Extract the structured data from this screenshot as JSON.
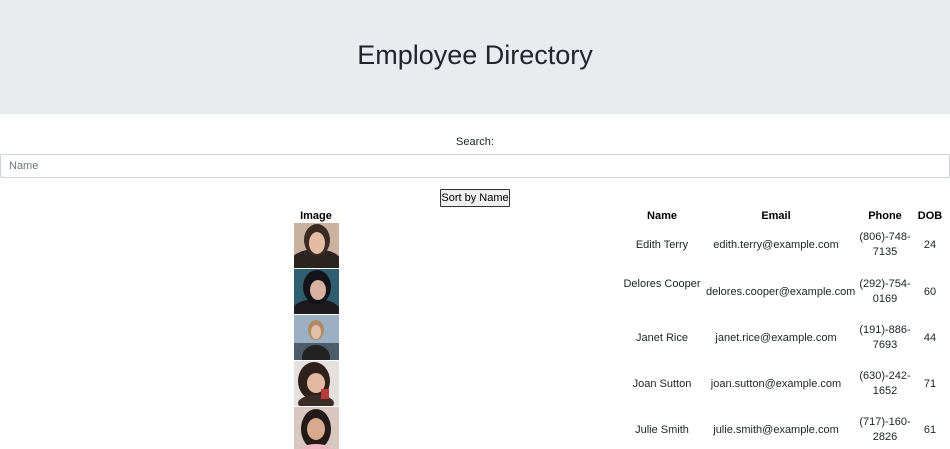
{
  "header": {
    "title": "Employee Directory"
  },
  "search": {
    "label": "Search:",
    "placeholder": "Name",
    "value": ""
  },
  "sort_button": {
    "label": "Sort by Name"
  },
  "table": {
    "columns": [
      "Image",
      "Name",
      "Email",
      "Phone",
      "DOB"
    ],
    "rows": [
      {
        "image": "employee-photo",
        "name": "Edith Terry",
        "email": "edith.terry@example.com",
        "phone": "(806)-748-7135",
        "dob": "24"
      },
      {
        "image": "employee-photo",
        "name": "Delores Cooper",
        "email": "delores.cooper@example.com",
        "phone": "(292)-754-0169",
        "dob": "60"
      },
      {
        "image": "employee-photo",
        "name": "Janet Rice",
        "email": "janet.rice@example.com",
        "phone": "(191)-886-7693",
        "dob": "44"
      },
      {
        "image": "employee-photo",
        "name": "Joan Sutton",
        "email": "joan.sutton@example.com",
        "phone": "(630)-242-1652",
        "dob": "71"
      },
      {
        "image": "employee-photo",
        "name": "Julie Smith",
        "email": "julie.smith@example.com",
        "phone": "(717)-160-2826",
        "dob": "61"
      }
    ]
  }
}
